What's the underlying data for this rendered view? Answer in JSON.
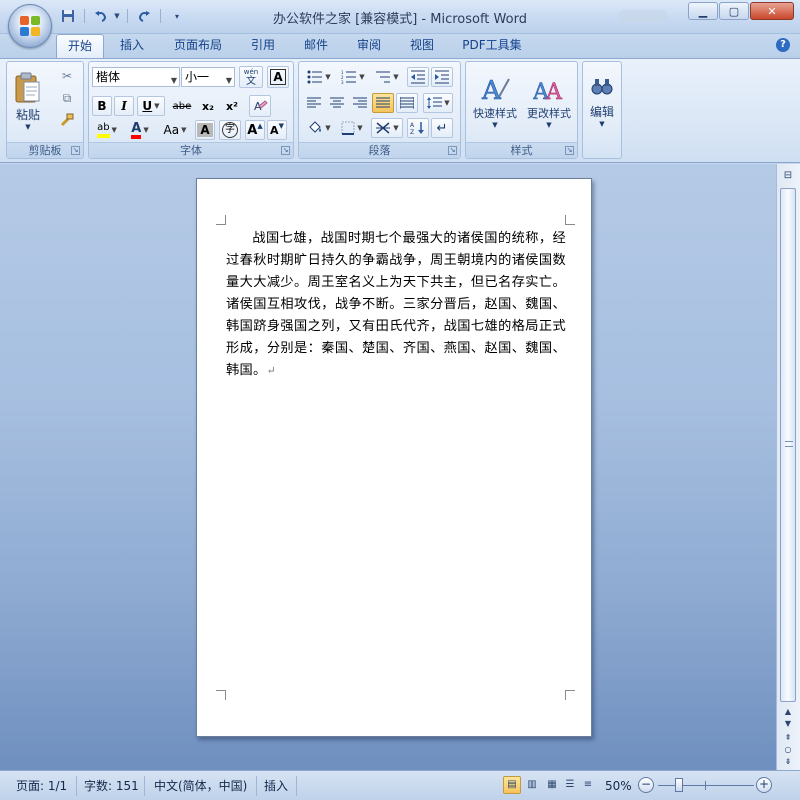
{
  "title_bar": {
    "title": "办公软件之家 [兼容模式] - Microsoft Word",
    "qat": [
      "save-icon",
      "undo-icon",
      "redo-icon",
      "customize-icon"
    ],
    "controls": [
      "minimize-icon",
      "maximize-icon",
      "close-icon"
    ]
  },
  "tabs": [
    "开始",
    "插入",
    "页面布局",
    "引用",
    "邮件",
    "审阅",
    "视图",
    "PDF工具集"
  ],
  "active_tab": "开始",
  "ribbon": {
    "clipboard": {
      "label": "剪贴板",
      "paste_label": "粘贴"
    },
    "font": {
      "label": "字体",
      "font_name": "楷体",
      "font_size": "小一",
      "wen_glyph": "wén\n文",
      "a_box": "A",
      "bold": "B",
      "italic": "I",
      "underline": "U",
      "strike": "abe",
      "subscript": "x₂",
      "superscript": "x²",
      "clear_format": "A",
      "highlight": "ab",
      "font_color": "A",
      "change_case": "Aa",
      "char_shading": "A",
      "enclose": "字",
      "grow": "A",
      "shrink": "A"
    },
    "paragraph": {
      "label": "段落"
    },
    "styles": {
      "label": "样式",
      "quick_styles": "快速样式",
      "change_styles": "更改样式"
    },
    "editing": {
      "label": "编辑"
    }
  },
  "document": {
    "text": "战国七雄，战国时期七个最强大的诸侯国的统称，经过春秋时期旷日持久的争霸战争，周王朝境内的诸侯国数量大大减少。周王室名义上为天下共主，但已名存实亡。诸侯国互相攻伐，战争不断。三家分晋后，赵国、魏国、韩国跻身强国之列，又有田氏代齐，战国七雄的格局正式形成，分别是：秦国、楚国、齐国、燕国、赵国、魏国、韩国。",
    "paragraph_mark": "↵"
  },
  "status_bar": {
    "page": "页面: 1/1",
    "words": "字数: 151",
    "language": "中文(简体，中国)",
    "mode": "插入",
    "zoom": "50%",
    "zoom_value": 50
  },
  "colors": {
    "highlight": "#ffff00",
    "font_color": "#ff0000",
    "accent": "#15428b"
  }
}
